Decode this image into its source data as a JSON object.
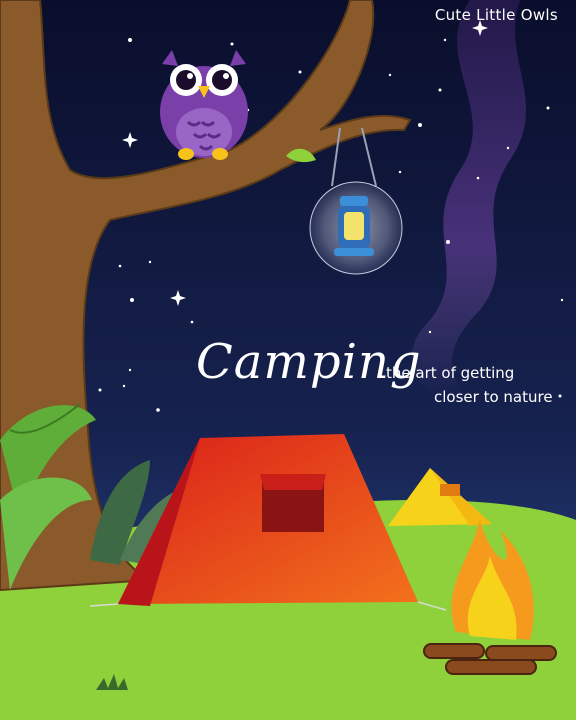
{
  "brand": "Cute Little Owls",
  "title": "Camping",
  "tagline_line1": "the art of getting",
  "tagline_line2": "closer to nature",
  "colors": {
    "sky_top": "#0b0f2f",
    "sky_bottom": "#1d2f6b",
    "grass": "#8fd13a",
    "tree": "#8a5a2b",
    "owl": "#7a3fa8",
    "tent_red": "#e8301c",
    "tent_yellow": "#f7d21a",
    "fire": "#f59a1c"
  }
}
